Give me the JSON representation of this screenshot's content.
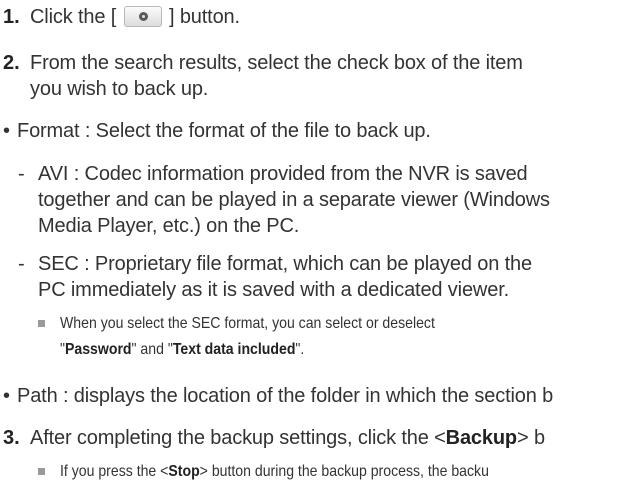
{
  "steps": {
    "step1": {
      "number": "1.",
      "text_before": "Click the [",
      "icon": "backup-disc-icon",
      "text_after": "] button."
    },
    "step2": {
      "number": "2.",
      "line1": "From the search results, select the check box of the item",
      "line2": "you wish to back up."
    },
    "step3": {
      "number": "3.",
      "text_before": "After completing the backup settings, click the <",
      "button_label": "Backup",
      "text_after": "> b"
    }
  },
  "format": {
    "bullet": "•",
    "text": "Format : Select the format of the file to back up.",
    "avi": {
      "dash": "-",
      "line1": "AVI : Codec information provided from the NVR is saved",
      "line2": "together and can be played in a separate viewer (Windows",
      "line3": "Media Player, etc.) on the PC."
    },
    "sec": {
      "dash": "-",
      "line1": "SEC : Proprietary file format, which can be played on the",
      "line2": "PC immediately as it is saved with a dedicated viewer."
    },
    "note": {
      "line1": "When you select the SEC format, you can select or deselect",
      "quote_open": "\"",
      "password": "Password",
      "and": "\" and \"",
      "text_data": "Text data included",
      "quote_close": "\"."
    }
  },
  "path": {
    "bullet": "•",
    "text": "Path : displays the location of the folder in which the section b"
  },
  "stop_note": {
    "text_before": "If you press the <",
    "button_label": "Stop",
    "text_after": "> button during the backup process, the backu"
  }
}
